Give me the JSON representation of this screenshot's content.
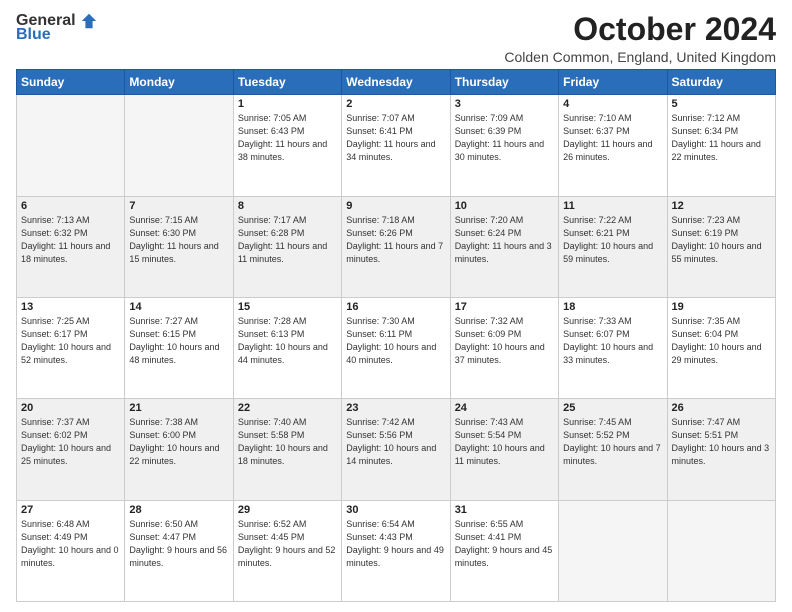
{
  "header": {
    "logo_general": "General",
    "logo_blue": "Blue",
    "month": "October 2024",
    "location": "Colden Common, England, United Kingdom"
  },
  "days_of_week": [
    "Sunday",
    "Monday",
    "Tuesday",
    "Wednesday",
    "Thursday",
    "Friday",
    "Saturday"
  ],
  "weeks": [
    [
      {
        "day": "",
        "info": ""
      },
      {
        "day": "",
        "info": ""
      },
      {
        "day": "1",
        "info": "Sunrise: 7:05 AM\nSunset: 6:43 PM\nDaylight: 11 hours and 38 minutes."
      },
      {
        "day": "2",
        "info": "Sunrise: 7:07 AM\nSunset: 6:41 PM\nDaylight: 11 hours and 34 minutes."
      },
      {
        "day": "3",
        "info": "Sunrise: 7:09 AM\nSunset: 6:39 PM\nDaylight: 11 hours and 30 minutes."
      },
      {
        "day": "4",
        "info": "Sunrise: 7:10 AM\nSunset: 6:37 PM\nDaylight: 11 hours and 26 minutes."
      },
      {
        "day": "5",
        "info": "Sunrise: 7:12 AM\nSunset: 6:34 PM\nDaylight: 11 hours and 22 minutes."
      }
    ],
    [
      {
        "day": "6",
        "info": "Sunrise: 7:13 AM\nSunset: 6:32 PM\nDaylight: 11 hours and 18 minutes."
      },
      {
        "day": "7",
        "info": "Sunrise: 7:15 AM\nSunset: 6:30 PM\nDaylight: 11 hours and 15 minutes."
      },
      {
        "day": "8",
        "info": "Sunrise: 7:17 AM\nSunset: 6:28 PM\nDaylight: 11 hours and 11 minutes."
      },
      {
        "day": "9",
        "info": "Sunrise: 7:18 AM\nSunset: 6:26 PM\nDaylight: 11 hours and 7 minutes."
      },
      {
        "day": "10",
        "info": "Sunrise: 7:20 AM\nSunset: 6:24 PM\nDaylight: 11 hours and 3 minutes."
      },
      {
        "day": "11",
        "info": "Sunrise: 7:22 AM\nSunset: 6:21 PM\nDaylight: 10 hours and 59 minutes."
      },
      {
        "day": "12",
        "info": "Sunrise: 7:23 AM\nSunset: 6:19 PM\nDaylight: 10 hours and 55 minutes."
      }
    ],
    [
      {
        "day": "13",
        "info": "Sunrise: 7:25 AM\nSunset: 6:17 PM\nDaylight: 10 hours and 52 minutes."
      },
      {
        "day": "14",
        "info": "Sunrise: 7:27 AM\nSunset: 6:15 PM\nDaylight: 10 hours and 48 minutes."
      },
      {
        "day": "15",
        "info": "Sunrise: 7:28 AM\nSunset: 6:13 PM\nDaylight: 10 hours and 44 minutes."
      },
      {
        "day": "16",
        "info": "Sunrise: 7:30 AM\nSunset: 6:11 PM\nDaylight: 10 hours and 40 minutes."
      },
      {
        "day": "17",
        "info": "Sunrise: 7:32 AM\nSunset: 6:09 PM\nDaylight: 10 hours and 37 minutes."
      },
      {
        "day": "18",
        "info": "Sunrise: 7:33 AM\nSunset: 6:07 PM\nDaylight: 10 hours and 33 minutes."
      },
      {
        "day": "19",
        "info": "Sunrise: 7:35 AM\nSunset: 6:04 PM\nDaylight: 10 hours and 29 minutes."
      }
    ],
    [
      {
        "day": "20",
        "info": "Sunrise: 7:37 AM\nSunset: 6:02 PM\nDaylight: 10 hours and 25 minutes."
      },
      {
        "day": "21",
        "info": "Sunrise: 7:38 AM\nSunset: 6:00 PM\nDaylight: 10 hours and 22 minutes."
      },
      {
        "day": "22",
        "info": "Sunrise: 7:40 AM\nSunset: 5:58 PM\nDaylight: 10 hours and 18 minutes."
      },
      {
        "day": "23",
        "info": "Sunrise: 7:42 AM\nSunset: 5:56 PM\nDaylight: 10 hours and 14 minutes."
      },
      {
        "day": "24",
        "info": "Sunrise: 7:43 AM\nSunset: 5:54 PM\nDaylight: 10 hours and 11 minutes."
      },
      {
        "day": "25",
        "info": "Sunrise: 7:45 AM\nSunset: 5:52 PM\nDaylight: 10 hours and 7 minutes."
      },
      {
        "day": "26",
        "info": "Sunrise: 7:47 AM\nSunset: 5:51 PM\nDaylight: 10 hours and 3 minutes."
      }
    ],
    [
      {
        "day": "27",
        "info": "Sunrise: 6:48 AM\nSunset: 4:49 PM\nDaylight: 10 hours and 0 minutes."
      },
      {
        "day": "28",
        "info": "Sunrise: 6:50 AM\nSunset: 4:47 PM\nDaylight: 9 hours and 56 minutes."
      },
      {
        "day": "29",
        "info": "Sunrise: 6:52 AM\nSunset: 4:45 PM\nDaylight: 9 hours and 52 minutes."
      },
      {
        "day": "30",
        "info": "Sunrise: 6:54 AM\nSunset: 4:43 PM\nDaylight: 9 hours and 49 minutes."
      },
      {
        "day": "31",
        "info": "Sunrise: 6:55 AM\nSunset: 4:41 PM\nDaylight: 9 hours and 45 minutes."
      },
      {
        "day": "",
        "info": ""
      },
      {
        "day": "",
        "info": ""
      }
    ]
  ],
  "shaded_rows": [
    1,
    3
  ]
}
